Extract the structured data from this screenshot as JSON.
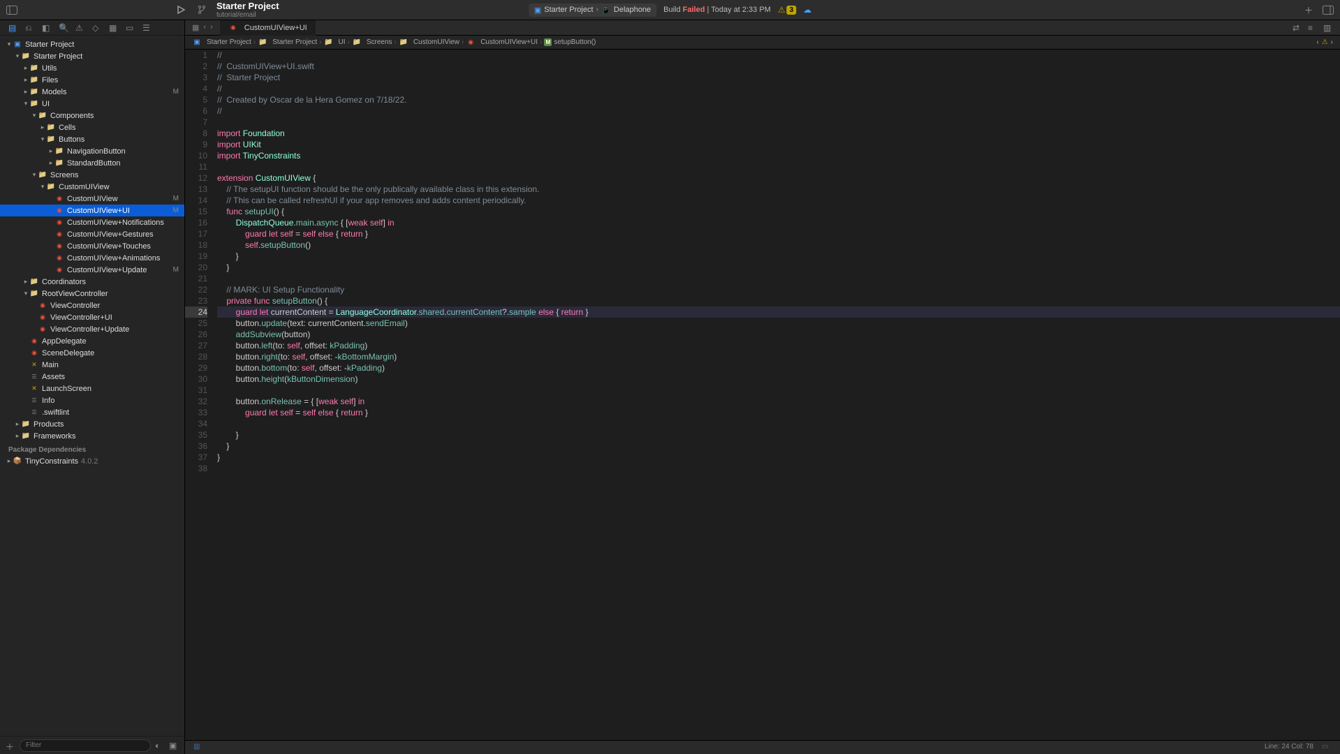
{
  "toolbar": {
    "project_title": "Starter Project",
    "project_subtitle": "tutorial/email",
    "scheme": "Starter Project",
    "destination": "Delaphone",
    "build_status_prefix": "Build ",
    "build_status_result": "Failed",
    "build_status_suffix": " | Today at 2:33 PM",
    "warning_count": "3"
  },
  "tree": {
    "root": "Starter Project",
    "items": [
      {
        "label": "Starter Project",
        "depth": 1,
        "icon": "folder",
        "chevron": "down"
      },
      {
        "label": "Utils",
        "depth": 2,
        "icon": "folder",
        "chevron": "right"
      },
      {
        "label": "Files",
        "depth": 2,
        "icon": "folder",
        "chevron": "right"
      },
      {
        "label": "Models",
        "depth": 2,
        "icon": "folder",
        "chevron": "right",
        "badge": "M"
      },
      {
        "label": "UI",
        "depth": 2,
        "icon": "folder",
        "chevron": "down"
      },
      {
        "label": "Components",
        "depth": 3,
        "icon": "folder",
        "chevron": "down"
      },
      {
        "label": "Cells",
        "depth": 4,
        "icon": "folder",
        "chevron": "right"
      },
      {
        "label": "Buttons",
        "depth": 4,
        "icon": "folder",
        "chevron": "down"
      },
      {
        "label": "NavigationButton",
        "depth": 5,
        "icon": "folder",
        "chevron": "right"
      },
      {
        "label": "StandardButton",
        "depth": 5,
        "icon": "folder",
        "chevron": "right"
      },
      {
        "label": "Screens",
        "depth": 3,
        "icon": "folder",
        "chevron": "down"
      },
      {
        "label": "CustomUIView",
        "depth": 4,
        "icon": "folder",
        "chevron": "down"
      },
      {
        "label": "CustomUIView",
        "depth": 5,
        "icon": "swift",
        "badge": "M"
      },
      {
        "label": "CustomUIView+UI",
        "depth": 5,
        "icon": "swift",
        "badge": "M",
        "selected": true
      },
      {
        "label": "CustomUIView+Notifications",
        "depth": 5,
        "icon": "swift"
      },
      {
        "label": "CustomUIView+Gestures",
        "depth": 5,
        "icon": "swift"
      },
      {
        "label": "CustomUIView+Touches",
        "depth": 5,
        "icon": "swift"
      },
      {
        "label": "CustomUIView+Animations",
        "depth": 5,
        "icon": "swift"
      },
      {
        "label": "CustomUIView+Update",
        "depth": 5,
        "icon": "swift",
        "badge": "M"
      },
      {
        "label": "Coordinators",
        "depth": 2,
        "icon": "folder",
        "chevron": "right"
      },
      {
        "label": "RootViewController",
        "depth": 2,
        "icon": "folder",
        "chevron": "down"
      },
      {
        "label": "ViewController",
        "depth": 3,
        "icon": "swift"
      },
      {
        "label": "ViewController+UI",
        "depth": 3,
        "icon": "swift"
      },
      {
        "label": "ViewController+Update",
        "depth": 3,
        "icon": "swift"
      },
      {
        "label": "AppDelegate",
        "depth": 2,
        "icon": "swift"
      },
      {
        "label": "SceneDelegate",
        "depth": 2,
        "icon": "swift"
      },
      {
        "label": "Main",
        "depth": 2,
        "icon": "yaml"
      },
      {
        "label": "Assets",
        "depth": 2,
        "icon": "plist"
      },
      {
        "label": "LaunchScreen",
        "depth": 2,
        "icon": "yaml"
      },
      {
        "label": "Info",
        "depth": 2,
        "icon": "plist"
      },
      {
        "label": ".swiftlint",
        "depth": 2,
        "icon": "plist"
      },
      {
        "label": "Products",
        "depth": 1,
        "icon": "folder",
        "chevron": "right"
      },
      {
        "label": "Frameworks",
        "depth": 1,
        "icon": "folder",
        "chevron": "right"
      }
    ],
    "package_section": "Package Dependencies",
    "package": {
      "name": "TinyConstraints",
      "version": "4.0.2"
    }
  },
  "filter": {
    "placeholder": "Filter"
  },
  "tabs": {
    "active": "CustomUIView+UI"
  },
  "breadcrumb": [
    {
      "icon": "app",
      "label": "Starter Project"
    },
    {
      "icon": "folder",
      "label": "Starter Project"
    },
    {
      "icon": "folder",
      "label": "UI"
    },
    {
      "icon": "folder",
      "label": "Screens"
    },
    {
      "icon": "folder",
      "label": "CustomUIView"
    },
    {
      "icon": "swift",
      "label": "CustomUIView+UI"
    },
    {
      "icon": "method",
      "label": "setupButton()"
    }
  ],
  "code": {
    "current_line": 24,
    "lines": [
      "//",
      "//  CustomUIView+UI.swift",
      "//  Starter Project",
      "//",
      "//  Created by Oscar de la Hera Gomez on 7/18/22.",
      "//",
      "",
      "import Foundation",
      "import UIKit",
      "import TinyConstraints",
      "",
      "extension CustomUIView {",
      "    // The setupUI function should be the only publically available class in this extension.",
      "    // This can be called refreshUI if your app removes and adds content periodically.",
      "    func setupUI() {",
      "        DispatchQueue.main.async { [weak self] in",
      "            guard let self = self else { return }",
      "            self.setupButton()",
      "        }",
      "    }",
      "",
      "    // MARK: UI Setup Functionality",
      "    private func setupButton() {",
      "        guard let currentContent = LanguageCoordinator.shared.currentContent?.sample else { return }",
      "        button.update(text: currentContent.sendEmail)",
      "        addSubview(button)",
      "        button.left(to: self, offset: kPadding)",
      "        button.right(to: self, offset: -kBottomMargin)",
      "        button.bottom(to: self, offset: -kPadding)",
      "        button.height(kButtonDimension)",
      "",
      "        button.onRelease = { [weak self] in",
      "            guard let self = self else { return }",
      "",
      "        }",
      "    }",
      "}",
      ""
    ]
  },
  "statusbar": {
    "line_col": "Line: 24  Col: 78"
  }
}
